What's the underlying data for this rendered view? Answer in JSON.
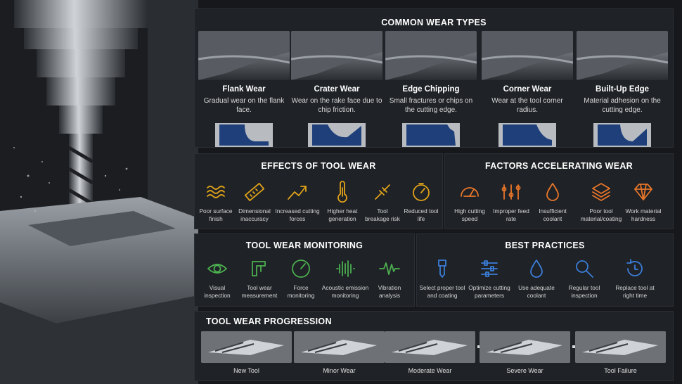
{
  "wear_types": {
    "title": "COMMON WEAR TYPES",
    "items": [
      {
        "name": "Flank Wear",
        "desc": "Gradual wear on the flank face."
      },
      {
        "name": "Crater Wear",
        "desc": "Wear on the rake face due to chip friction."
      },
      {
        "name": "Edge Chipping",
        "desc": "Small fractures or chips on the cutting edge."
      },
      {
        "name": "Corner Wear",
        "desc": "Wear at the tool corner radius."
      },
      {
        "name": "Built-Up Edge",
        "desc": "Material adhesion on the cutting edge."
      }
    ]
  },
  "effects": {
    "title": "EFFECTS OF TOOL WEAR",
    "items": [
      {
        "icon": "wave-lines-icon",
        "label": "Poor surface finish"
      },
      {
        "icon": "ruler-icon",
        "label": "Dimensional inaccuracy"
      },
      {
        "icon": "trend-up-arrow-icon",
        "label": "Increased cutting forces"
      },
      {
        "icon": "thermometer-icon",
        "label": "Higher heat generation"
      },
      {
        "icon": "broken-tool-icon",
        "label": "Tool breakage risk"
      },
      {
        "icon": "timer-icon",
        "label": "Reduced tool life"
      }
    ]
  },
  "factors": {
    "title": "FACTORS ACCELERATING WEAR",
    "items": [
      {
        "icon": "speedometer-icon",
        "label": "High cutting speed"
      },
      {
        "icon": "sliders-icon",
        "label": "Improper feed rate"
      },
      {
        "icon": "droplet-icon",
        "label": "Insufficient coolant"
      },
      {
        "icon": "layers-icon",
        "label": "Poor tool material/coating"
      },
      {
        "icon": "diamond-icon",
        "label": "Work material hardness"
      }
    ]
  },
  "monitoring": {
    "title": "TOOL WEAR MONITORING",
    "items": [
      {
        "icon": "eye-icon",
        "label": "Visual inspection"
      },
      {
        "icon": "caliper-icon",
        "label": "Tool wear measurement"
      },
      {
        "icon": "gauge-icon",
        "label": "Force monitoring"
      },
      {
        "icon": "sound-wave-icon",
        "label": "Acoustic emission monitoring"
      },
      {
        "icon": "vibration-icon",
        "label": "Vibration analysis"
      }
    ]
  },
  "practices": {
    "title": "BEST PRACTICES",
    "items": [
      {
        "icon": "tool-holder-icon",
        "label": "Select proper tool and coating"
      },
      {
        "icon": "adjust-sliders-icon",
        "label": "Optimize cutting parameters"
      },
      {
        "icon": "coolant-drop-icon",
        "label": "Use adequate coolant"
      },
      {
        "icon": "magnifier-icon",
        "label": "Regular tool inspection"
      },
      {
        "icon": "refresh-timer-icon",
        "label": "Replace tool at right time"
      }
    ]
  },
  "progression": {
    "title": "TOOL WEAR PROGRESSION",
    "stages": [
      "New Tool",
      "Minor Wear",
      "Moderate Wear",
      "Severe Wear",
      "Tool Failure"
    ]
  },
  "colors": {
    "background": "#16181b",
    "panel": "#1f2226",
    "profile_blue": "#1f3f7a",
    "effects_accent": "#e0a21a",
    "factors_accent": "#e8762a",
    "monitoring_accent": "#4caf50",
    "practices_accent": "#3b7dd8"
  }
}
